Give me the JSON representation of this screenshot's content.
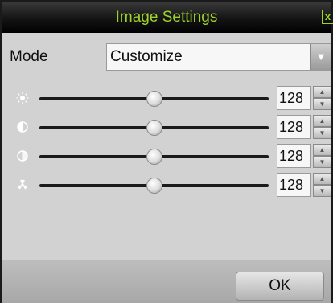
{
  "dialog": {
    "title": "Image Settings",
    "close_glyph": "x",
    "close_icon": "close-icon"
  },
  "mode": {
    "label": "Mode",
    "value": "Customize",
    "arrow_icon": "chevron-down-icon"
  },
  "settings": [
    {
      "icon": "brightness-icon",
      "value": "128",
      "level": 0.5
    },
    {
      "icon": "contrast-icon",
      "value": "128",
      "level": 0.5
    },
    {
      "icon": "saturation-icon",
      "value": "128",
      "level": 0.5
    },
    {
      "icon": "hue-icon",
      "value": "128",
      "level": 0.5
    }
  ],
  "footer": {
    "ok_label": "OK"
  },
  "colors": {
    "title_text": "#9ed32a",
    "title_bar": "#000000",
    "dialog_bg": "#d2d2d2"
  }
}
